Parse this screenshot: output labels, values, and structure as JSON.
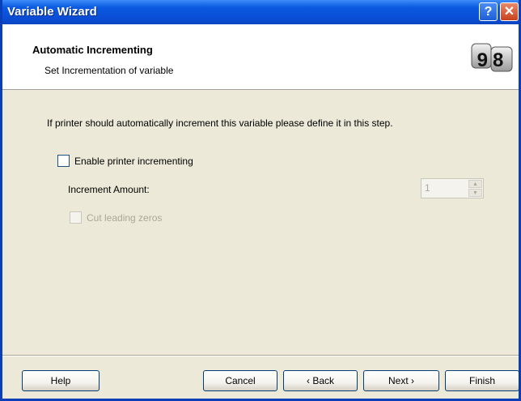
{
  "window": {
    "title": "Variable Wizard",
    "help_glyph": "?",
    "close_glyph": "✕"
  },
  "header": {
    "title": "Automatic Incrementing",
    "subtitle": "Set Incrementation of variable",
    "logo_text": "98",
    "icon": "counter-digits-icon"
  },
  "content": {
    "description": "If printer should automatically increment this variable please define it in this step.",
    "enable_label": "Enable printer incrementing",
    "enable_checked": false,
    "amount_label": "Increment Amount:",
    "amount_value": "1",
    "zeros_label": "Cut leading zeros",
    "zeros_checked": false
  },
  "buttons": {
    "help": "Help",
    "cancel": "Cancel",
    "back": "‹ Back",
    "next": "Next ›",
    "finish": "Finish"
  },
  "colors": {
    "titlebar": "#0a4fd8",
    "dialog_bg": "#ece9d8",
    "disabled_text": "#aca899"
  }
}
